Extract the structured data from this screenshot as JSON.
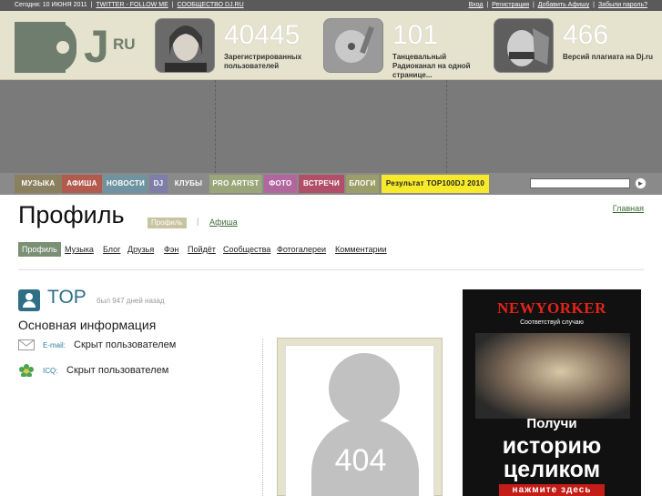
{
  "topbar": {
    "date": "Сегодня: 10 ИЮНЯ 2011",
    "twitter": "TWITTER - FOLLOW ME",
    "community": "СООБЩЕСТВО DJ.RU",
    "login": "Вход",
    "register": "Регистрация",
    "add_poster": "Добавить Афишу",
    "forgot": "Забыли пароль?"
  },
  "header": {
    "logo_letters": "J",
    "logo_suffix": "RU",
    "stats": [
      {
        "value": "40445",
        "caption": "Зарегистрированных пользователей"
      },
      {
        "value": "101",
        "caption": "Танцевальный Радиоканал на одной странице..."
      },
      {
        "value": "466",
        "caption": "Версий плагиата на Dj.ru"
      }
    ]
  },
  "nav": {
    "items": [
      {
        "label": "МУЗЫКА",
        "color": "#8a7f5e"
      },
      {
        "label": "АФИША",
        "color": "#b25a4e"
      },
      {
        "label": "НОВОСТИ",
        "color": "#6f93a0"
      },
      {
        "label": "DJ",
        "color": "#7e7fa8"
      },
      {
        "label": "КЛУБЫ",
        "color": "#8a8a8a"
      },
      {
        "label": "PRO ARTIST",
        "color": "#9aa67a"
      },
      {
        "label": "ФОТО",
        "color": "#b1679e"
      },
      {
        "label": "ВСТРЕЧИ",
        "color": "#b04f67"
      },
      {
        "label": "БЛОГИ",
        "color": "#9c9e6a"
      },
      {
        "label": "Результат TOP100DJ 2010",
        "color": "#f7ea2a"
      }
    ],
    "search_value": "",
    "go_icon": "arrow-right-icon"
  },
  "page": {
    "title": "Профиль",
    "pill": "Профиль",
    "pipe": "|",
    "afisha_link": "Афиша",
    "home_link": "Главная"
  },
  "tabs": [
    {
      "label": "Профиль",
      "active": true
    },
    {
      "label": "Музыка"
    },
    {
      "label": "Блог"
    },
    {
      "label": "Друзья"
    },
    {
      "label": "Фэн"
    },
    {
      "label": "Пойдёт"
    },
    {
      "label": "Сообщества"
    },
    {
      "label": "Фотогалереи"
    },
    {
      "label": "Комментарии"
    }
  ],
  "user": {
    "name": "TOP",
    "last_seen": "был 947 дней назад",
    "section_title": "Основная информация",
    "email_label": "E-mail:",
    "email_value": "Скрыт пользователем",
    "icq_label": "ICQ:",
    "icq_value": "Скрыт пользователем",
    "avatar_code": "404"
  },
  "ad": {
    "brand": "NEWYORKER",
    "slogan": "Соответствуй случаю",
    "line1": "Получи",
    "line2": "историю",
    "line3": "целиком",
    "cta": "нажмите здесь"
  }
}
